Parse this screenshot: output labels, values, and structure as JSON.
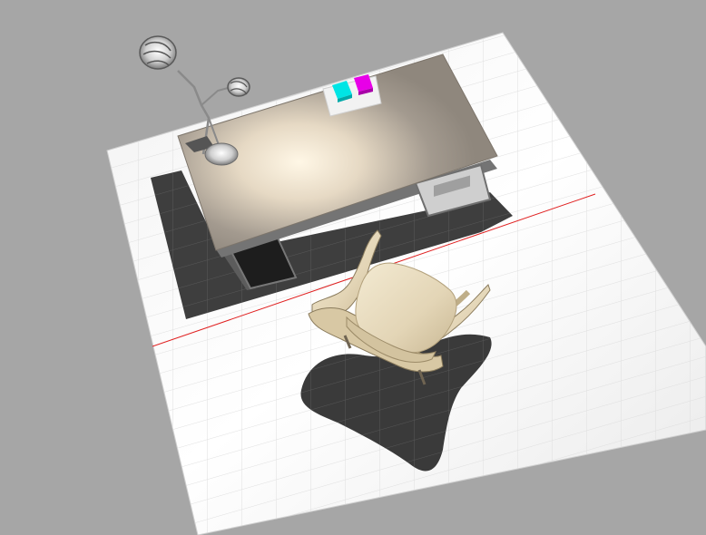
{
  "scene": {
    "background_color": "#a6a6a6",
    "floor_color": "#ffffff",
    "floor_grid_color": "#d8d8d8",
    "shadow_color": "#3a3a3a",
    "desk_top_color": "#a39a8f",
    "desk_leg_color": "#6b6b6b",
    "chair_color": "#e7dbbf",
    "boundary_line_color": "#e02020",
    "objects": [
      {
        "name": "floor-lamp",
        "icon": "lamp-icon"
      },
      {
        "name": "desk",
        "icon": "desk-icon"
      },
      {
        "name": "chair",
        "icon": "chair-icon"
      },
      {
        "name": "cyan-cube",
        "color": "#00e5e5"
      },
      {
        "name": "magenta-cube",
        "color": "#e800e8"
      }
    ]
  }
}
